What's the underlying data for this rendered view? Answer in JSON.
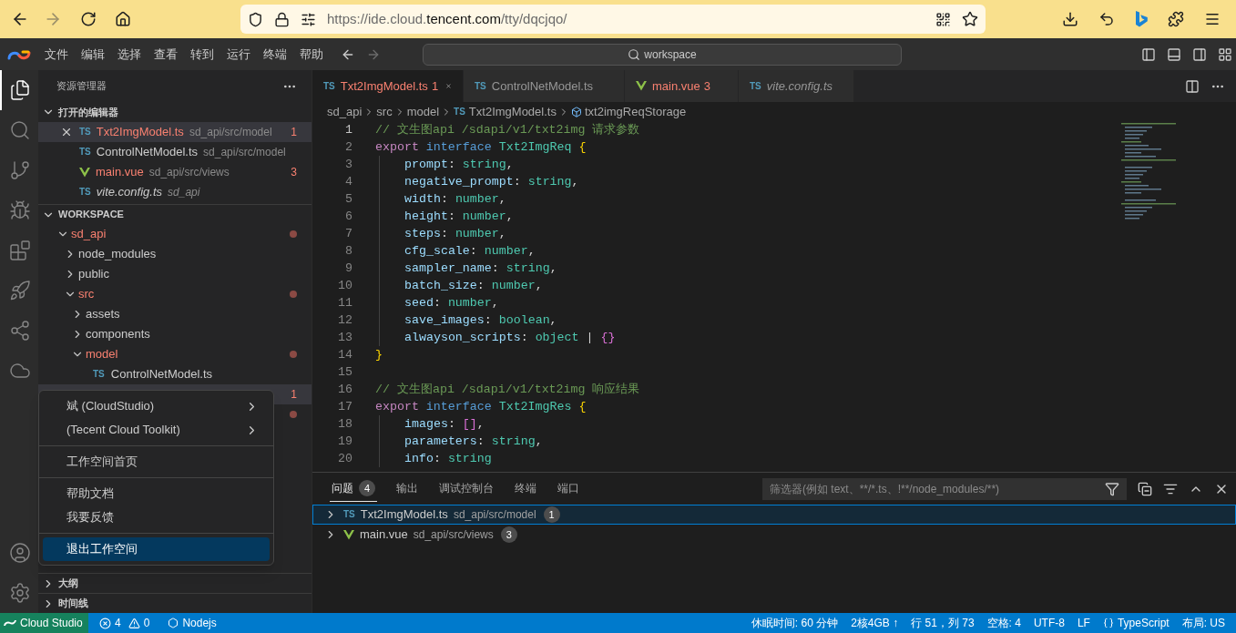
{
  "browser": {
    "back_disabled": false,
    "forward_disabled": true,
    "url": {
      "prefix": "https://ide.cloud.",
      "domain": "tencent.com",
      "suffix": "/tty/dqcjqo/"
    }
  },
  "menu_bar": {
    "items": [
      "文件",
      "编辑",
      "选择",
      "查看",
      "转到",
      "运行",
      "终端",
      "帮助"
    ],
    "command_center": "workspace"
  },
  "activity_bar": {
    "top": [
      {
        "kind": "explorer",
        "selected": true
      },
      {
        "kind": "search",
        "selected": false
      },
      {
        "kind": "source-control",
        "selected": false
      },
      {
        "kind": "debug",
        "selected": false
      },
      {
        "kind": "extensions",
        "selected": false
      },
      {
        "kind": "deploy",
        "selected": false
      },
      {
        "kind": "share",
        "selected": false
      },
      {
        "kind": "cloud",
        "selected": false
      }
    ],
    "bottom": [
      {
        "kind": "account",
        "selected": false
      },
      {
        "kind": "settings",
        "selected": false
      }
    ]
  },
  "sidebar": {
    "title": "资源管理器",
    "open_editors": {
      "title": "打开的编辑器",
      "expanded": true,
      "items": [
        {
          "kind": "ts",
          "type_label": "TS",
          "name": "Txt2ImgModel.ts",
          "path": "sd_api/src/model",
          "problems": "1",
          "has_errors": true,
          "selected": true,
          "preview": false
        },
        {
          "kind": "ts",
          "type_label": "TS",
          "name": "ControlNetModel.ts",
          "path": "sd_api/src/model",
          "has_errors": false,
          "selected": false,
          "preview": false
        },
        {
          "kind": "vue",
          "name": "main.vue",
          "path": "sd_api/src/views",
          "problems": "3",
          "has_errors": true,
          "selected": false,
          "preview": false
        },
        {
          "kind": "ts",
          "type_label": "TS",
          "name": "vite.config.ts",
          "path": "sd_api",
          "has_errors": false,
          "selected": false,
          "preview": true
        }
      ]
    },
    "workspace": {
      "title": "WORKSPACE",
      "expanded": true,
      "tree": [
        {
          "kind": "folder",
          "name": "sd_api",
          "expanded": true,
          "has_errors": true,
          "selected": false,
          "children": [
            {
              "kind": "folder",
              "name": "node_modules",
              "expanded": false,
              "has_errors": false,
              "selected": false
            },
            {
              "kind": "folder",
              "name": "public",
              "expanded": false,
              "has_errors": false,
              "selected": false
            },
            {
              "kind": "folder",
              "name": "src",
              "expanded": true,
              "has_errors": true,
              "selected": false,
              "children": [
                {
                  "kind": "folder",
                  "name": "assets",
                  "expanded": false,
                  "has_errors": false,
                  "selected": false
                },
                {
                  "kind": "folder",
                  "name": "components",
                  "expanded": false,
                  "has_errors": false,
                  "selected": false
                },
                {
                  "kind": "folder",
                  "name": "model",
                  "expanded": true,
                  "has_errors": true,
                  "selected": false,
                  "children": [
                    {
                      "kind": "ts",
                      "type_label": "TS",
                      "name": "ControlNetModel.ts",
                      "has_errors": false,
                      "selected": false
                    },
                    {
                      "kind": "covered",
                      "problems": "1",
                      "has_errors": true,
                      "selected": true
                    }
                  ]
                },
                {
                  "kind": "covered",
                  "has_errors": true,
                  "selected": false
                }
              ]
            }
          ]
        }
      ]
    },
    "sections": [
      {
        "title": "大纲",
        "expanded": false
      },
      {
        "title": "时间线",
        "expanded": false
      }
    ]
  },
  "context_menu": {
    "groups": [
      [
        {
          "label": "斌 (CloudStudio)",
          "submenu": true,
          "selected": false
        },
        {
          "label": "(Tecent Cloud Toolkit)",
          "submenu": true,
          "selected": false
        }
      ],
      [
        {
          "label": "工作空间首页",
          "submenu": false,
          "selected": false
        }
      ],
      [
        {
          "label": "帮助文档",
          "submenu": false,
          "selected": false
        },
        {
          "label": "我要反馈",
          "submenu": false,
          "selected": false
        }
      ],
      [
        {
          "label": "退出工作空间",
          "submenu": false,
          "selected": true
        }
      ]
    ]
  },
  "editor": {
    "tabs": [
      {
        "kind": "ts",
        "type_label": "TS",
        "name": "Txt2ImgModel.ts",
        "problems": "1",
        "has_errors": true,
        "selected": true,
        "preview": false
      },
      {
        "kind": "ts",
        "type_label": "TS",
        "name": "ControlNetModel.ts",
        "has_errors": false,
        "selected": false,
        "preview": false
      },
      {
        "kind": "vue",
        "name": "main.vue",
        "problems": "3",
        "has_errors": true,
        "selected": false,
        "preview": false
      },
      {
        "kind": "ts",
        "type_label": "TS",
        "name": "vite.config.ts",
        "has_errors": false,
        "selected": false,
        "preview": true
      }
    ],
    "breadcrumb": [
      {
        "kind": "text",
        "label": "sd_api"
      },
      {
        "kind": "text",
        "label": "src"
      },
      {
        "kind": "text",
        "label": "model"
      },
      {
        "kind": "ts",
        "type_label": "TS",
        "label": "Txt2ImgModel.ts"
      },
      {
        "kind": "symbol",
        "label": "txt2imgReqStorage"
      }
    ],
    "lines": [
      {
        "number": "1",
        "indent": false,
        "tokens": [
          {
            "kind": "comment",
            "text": "// 文生图api /sdapi/v1/txt2img 请求参数"
          }
        ]
      },
      {
        "number": "2",
        "indent": false,
        "tokens": [
          {
            "kind": "keyword",
            "text": "export"
          },
          {
            "kind": "storage",
            "text": " interface"
          },
          {
            "kind": "type",
            "text": " Txt2ImgReq"
          },
          {
            "kind": "brace",
            "text": " {"
          }
        ]
      },
      {
        "number": "3",
        "indent": true,
        "tokens": [
          {
            "kind": "prop",
            "text": "prompt"
          },
          {
            "kind": "plain",
            "text": ": "
          },
          {
            "kind": "type",
            "text": "string"
          },
          {
            "kind": "plain",
            "text": ","
          }
        ]
      },
      {
        "number": "4",
        "indent": true,
        "tokens": [
          {
            "kind": "prop",
            "text": "negative_prompt"
          },
          {
            "kind": "plain",
            "text": ": "
          },
          {
            "kind": "type",
            "text": "string"
          },
          {
            "kind": "plain",
            "text": ","
          }
        ]
      },
      {
        "number": "5",
        "indent": true,
        "tokens": [
          {
            "kind": "prop",
            "text": "width"
          },
          {
            "kind": "plain",
            "text": ": "
          },
          {
            "kind": "type",
            "text": "number"
          },
          {
            "kind": "plain",
            "text": ","
          }
        ]
      },
      {
        "number": "6",
        "indent": true,
        "tokens": [
          {
            "kind": "prop",
            "text": "height"
          },
          {
            "kind": "plain",
            "text": ": "
          },
          {
            "kind": "type",
            "text": "number"
          },
          {
            "kind": "plain",
            "text": ","
          }
        ]
      },
      {
        "number": "7",
        "indent": true,
        "tokens": [
          {
            "kind": "prop",
            "text": "steps"
          },
          {
            "kind": "plain",
            "text": ": "
          },
          {
            "kind": "type",
            "text": "number"
          },
          {
            "kind": "plain",
            "text": ","
          }
        ]
      },
      {
        "number": "8",
        "indent": true,
        "tokens": [
          {
            "kind": "prop",
            "text": "cfg_scale"
          },
          {
            "kind": "plain",
            "text": ": "
          },
          {
            "kind": "type",
            "text": "number"
          },
          {
            "kind": "plain",
            "text": ","
          }
        ]
      },
      {
        "number": "9",
        "indent": true,
        "tokens": [
          {
            "kind": "prop",
            "text": "sampler_name"
          },
          {
            "kind": "plain",
            "text": ": "
          },
          {
            "kind": "type",
            "text": "string"
          },
          {
            "kind": "plain",
            "text": ","
          }
        ]
      },
      {
        "number": "10",
        "indent": true,
        "tokens": [
          {
            "kind": "prop",
            "text": "batch_size"
          },
          {
            "kind": "plain",
            "text": ": "
          },
          {
            "kind": "type",
            "text": "number"
          },
          {
            "kind": "plain",
            "text": ","
          }
        ]
      },
      {
        "number": "11",
        "indent": true,
        "tokens": [
          {
            "kind": "prop",
            "text": "seed"
          },
          {
            "kind": "plain",
            "text": ": "
          },
          {
            "kind": "type",
            "text": "number"
          },
          {
            "kind": "plain",
            "text": ","
          }
        ]
      },
      {
        "number": "12",
        "indent": true,
        "tokens": [
          {
            "kind": "prop",
            "text": "save_images"
          },
          {
            "kind": "plain",
            "text": ": "
          },
          {
            "kind": "type",
            "text": "boolean"
          },
          {
            "kind": "plain",
            "text": ","
          }
        ]
      },
      {
        "number": "13",
        "indent": true,
        "tokens": [
          {
            "kind": "prop",
            "text": "alwayson_scripts"
          },
          {
            "kind": "plain",
            "text": ": "
          },
          {
            "kind": "type",
            "text": "object"
          },
          {
            "kind": "plain",
            "text": " | "
          },
          {
            "kind": "brace2",
            "text": "{}"
          }
        ]
      },
      {
        "number": "14",
        "indent": false,
        "tokens": [
          {
            "kind": "brace",
            "text": "}"
          }
        ]
      },
      {
        "number": "15",
        "indent": false
      },
      {
        "number": "16",
        "indent": false,
        "tokens": [
          {
            "kind": "comment",
            "text": "// 文生图api /sdapi/v1/txt2img 响应结果"
          }
        ]
      },
      {
        "number": "17",
        "indent": false,
        "tokens": [
          {
            "kind": "keyword",
            "text": "export"
          },
          {
            "kind": "storage",
            "text": " interface"
          },
          {
            "kind": "type",
            "text": " Txt2ImgRes"
          },
          {
            "kind": "brace",
            "text": " {"
          }
        ]
      },
      {
        "number": "18",
        "indent": true,
        "tokens": [
          {
            "kind": "prop",
            "text": "images"
          },
          {
            "kind": "plain",
            "text": ": "
          },
          {
            "kind": "bracket",
            "text": "[]"
          },
          {
            "kind": "plain",
            "text": ","
          }
        ]
      },
      {
        "number": "19",
        "indent": true,
        "tokens": [
          {
            "kind": "prop",
            "text": "parameters"
          },
          {
            "kind": "plain",
            "text": ": "
          },
          {
            "kind": "type",
            "text": "string"
          },
          {
            "kind": "plain",
            "text": ","
          }
        ]
      },
      {
        "number": "20",
        "indent": true,
        "tokens": [
          {
            "kind": "prop",
            "text": "info"
          },
          {
            "kind": "plain",
            "text": ": "
          },
          {
            "kind": "type",
            "text": "string"
          }
        ]
      }
    ]
  },
  "panel": {
    "tabs": [
      {
        "label": "问题",
        "count": "4",
        "selected": true
      },
      {
        "label": "输出",
        "selected": false
      },
      {
        "label": "调试控制台",
        "selected": false
      },
      {
        "label": "终端",
        "selected": false
      },
      {
        "label": "端口",
        "selected": false
      }
    ],
    "filter": {
      "placeholder": "筛选器(例如 text、**/*.ts、!**/node_modules/**)"
    },
    "problems": [
      {
        "kind": "ts",
        "type_label": "TS",
        "name": "Txt2ImgModel.ts",
        "path": "sd_api/src/model",
        "count": "1",
        "selected": true,
        "expanded": false
      },
      {
        "kind": "vue",
        "name": "main.vue",
        "path": "sd_api/src/views",
        "count": "3",
        "selected": false,
        "expanded": false
      }
    ]
  },
  "status_bar": {
    "remote": "Cloud Studio",
    "errors": "4",
    "warnings": "0",
    "runtime": "Nodejs",
    "right": [
      "休眠时间: 60 分钟",
      "2核4GB ↑",
      "行 51，列 73",
      "空格: 4",
      "UTF-8",
      "LF"
    ],
    "language": "TypeScript",
    "layout": "布局: US"
  }
}
